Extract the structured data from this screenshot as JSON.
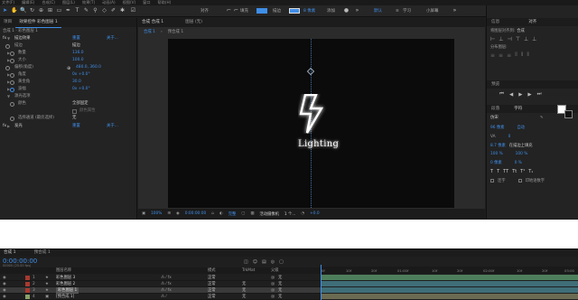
{
  "menu": [
    "文件(F)",
    "编辑(E)",
    "合成(C)",
    "图层(L)",
    "效果(T)",
    "动画(A)",
    "视图(V)",
    "窗口",
    "帮助(H)"
  ],
  "toolbar": {
    "snap_label": "对齐",
    "fill_label": "填充",
    "stroke_label": "描边",
    "stroke_value": "8 像素",
    "add_label": "添加",
    "workspace_default": "默认",
    "workspace_learn": "学习",
    "workspace_small": "小屏幕",
    "search_placeholder": "搜索帮助"
  },
  "effect_panel": {
    "tab_project": "项目",
    "tab_effects": "效果控件 彩色图层 1",
    "breadcrumb": "合成 1 · 彩色图层 1",
    "effect1_name": "描边效果",
    "reset": "重置",
    "about": "关于...",
    "rows": [
      {
        "label": "描边",
        "value": "描边"
      },
      {
        "label": "数量",
        "value": "136.0"
      },
      {
        "label": "大小",
        "value": "100.0"
      },
      {
        "label": "偏移(角度)",
        "value": "480.0, 360.0"
      },
      {
        "label": "角度",
        "value": "0x +0.0°"
      },
      {
        "label": "黄金角",
        "value": "30.0"
      },
      {
        "label": "波幅",
        "value": "0x +0.0°"
      }
    ],
    "subgroup": "源光选项",
    "color_label": "颜色",
    "color_value": "全部固定",
    "checkbox_label": "颜色属性",
    "mask_label": "选择通道 (最优选择)",
    "mask_value": "无",
    "effect2_name": "发光",
    "effect2_reset": "重置",
    "effect2_about": "关于..."
  },
  "viewer": {
    "tab_comp": "合成 合成 1",
    "tab_layer": "图层 (无)",
    "crumb1": "合成 1",
    "crumb2": "预合成 1",
    "canvas_text": "Lighting",
    "footer_zoom": "100%",
    "footer_time": "0:00:00:00",
    "footer_res": "完整",
    "footer_camera": "活动摄像机",
    "footer_views": "1 个...",
    "footer_exposure": "+0.0"
  },
  "right_panels": {
    "tab_info": "信息",
    "tab_align": "对齐",
    "align_to_label": "将图层对齐到:",
    "align_to_value": "合成",
    "distribute_label": "分布图层:",
    "preview_title": "预览",
    "char_tab1": "段落",
    "char_tab2": "字符",
    "font_name": "仿宋",
    "font_size": "96 像素",
    "leading": "自动",
    "tracking": "0",
    "stroke_width": "8.7 像素",
    "stroke_mode": "在描边上填充",
    "vscale": "100 %",
    "hscale": "100 %",
    "baseline": "0 像素",
    "tsume": "0 %",
    "ligature_label": "连字",
    "hindi_label": "印地语数字"
  },
  "timeline": {
    "tab1": "合成 1",
    "tab2": "预合成 1",
    "timecode": "0:00:00:00",
    "fps": "00000 (25.00 fps)",
    "col_name": "图层名称",
    "col_mode": "模式",
    "col_trkmat": "TrkMat",
    "col_parent": "父级",
    "ruler": [
      "0f",
      "10f",
      "20f",
      "01:00f",
      "10f",
      "20f",
      "02:00f",
      "10f",
      "20f",
      "03:00"
    ],
    "layers": [
      {
        "num": "1",
        "name": "彩色图层 3",
        "mode": "正常",
        "trkmat": "",
        "parent": "无",
        "color": "#a8392f"
      },
      {
        "num": "2",
        "name": "彩色图层 2",
        "mode": "正常",
        "trkmat": "无",
        "parent": "无",
        "color": "#a8392f"
      },
      {
        "num": "3",
        "name": "彩色图层 1",
        "mode": "正常",
        "trkmat": "无",
        "parent": "无",
        "color": "#a8392f"
      },
      {
        "num": "4",
        "name": "[预合成 1]",
        "mode": "正常",
        "trkmat": "无",
        "parent": "无",
        "color": "#8aa06a"
      }
    ]
  },
  "colors": {
    "accent": "#3f8ee8",
    "bar_green": "#4e7f5d",
    "bar_teal": "#3f6e78"
  }
}
